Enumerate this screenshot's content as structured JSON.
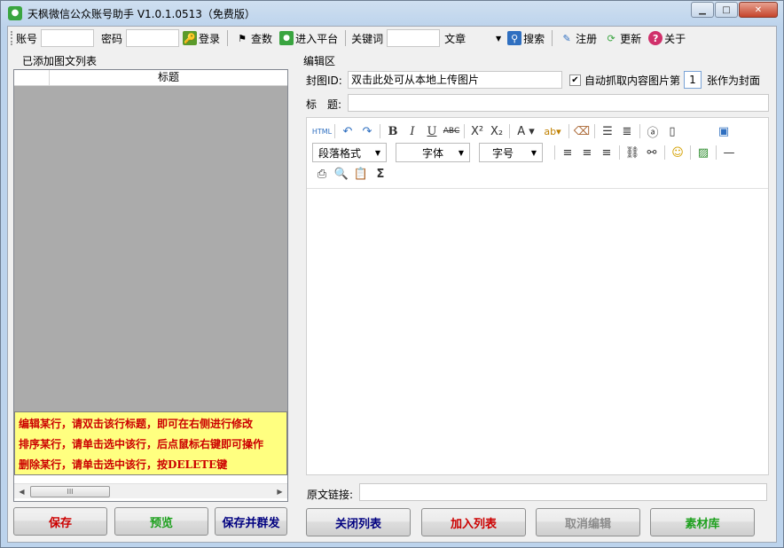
{
  "window": {
    "title": "天枫微信公众账号助手 V1.0.1.0513（免费版）",
    "app_icon": "wechat-icon"
  },
  "toolbar": {
    "account_label": "账号",
    "password_label": "密码",
    "login_label": "登录",
    "count_label": "查数",
    "enter_platform_label": "进入平台",
    "keyword_label": "关键词",
    "keyword_value": "",
    "type_select": "文章",
    "search_label": "搜索",
    "register_label": "注册",
    "update_label": "更新",
    "about_label": "关于"
  },
  "left_panel": {
    "group_label": "已添加图文列表",
    "column_header": "标题",
    "hints": [
      "编辑某行，请双击该行标题，即可在右侧进行修改",
      "排序某行，请单击选中该行，后点鼠标右键即可操作",
      "删除某行，请单击选中该行，按DELETE键"
    ],
    "buttons": {
      "save": "保存",
      "preview": "预览",
      "save_send": "保存并群发"
    }
  },
  "editor_panel": {
    "group_label": "编辑区",
    "cover_label": "封图ID:",
    "cover_value": "双击此处可从本地上传图片",
    "auto_grab_label": "自动抓取内容图片第",
    "auto_grab_checked": true,
    "auto_grab_index": "1",
    "as_cover_label": "张作为封面",
    "title_label": "标　题:",
    "title_value": "",
    "paragraph_format": "段落格式",
    "font_family": "字体",
    "font_size": "字号",
    "source_link_label": "原文链接:",
    "source_link_value": "",
    "buttons": {
      "close_list": "关闭列表",
      "add_to_list": "加入列表",
      "cancel_edit": "取消编辑",
      "material_lib": "素材库"
    }
  },
  "colors": {
    "hint_text": "#cc0000",
    "hint_bg": "#ffff80",
    "save_text": "#cc0000",
    "preview_text": "#1ea01e",
    "save_send_text": "#000080",
    "close_list_text": "#000080",
    "add_list_text": "#cc0000",
    "cancel_edit_text": "#8c8c8c",
    "material_text": "#1ea01e"
  }
}
